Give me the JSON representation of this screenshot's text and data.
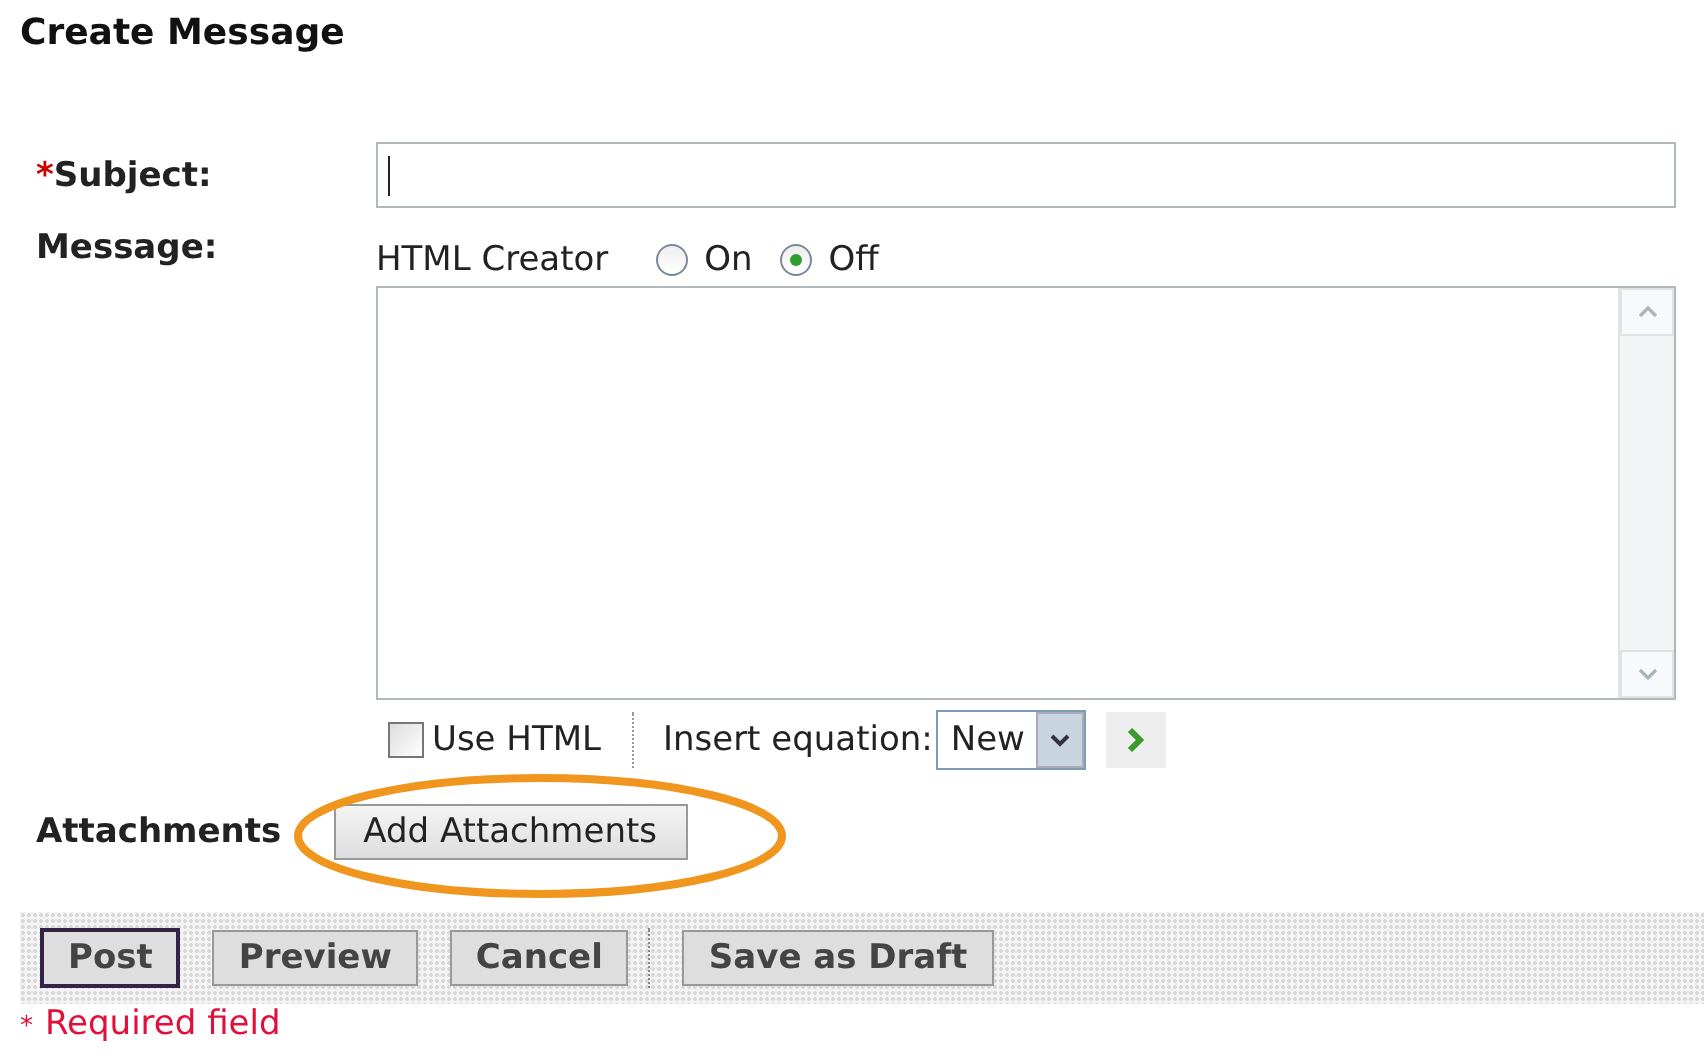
{
  "title": "Create Message",
  "subject": {
    "required_mark": "*",
    "label": "Subject:"
  },
  "message": {
    "label": "Message:",
    "html_creator": {
      "label": "HTML Creator",
      "options": [
        {
          "label": "On",
          "selected": false
        },
        {
          "label": "Off",
          "selected": true
        }
      ]
    }
  },
  "use_html": {
    "label": "Use HTML",
    "checked": false
  },
  "insert_equation": {
    "label": "Insert equation:",
    "value": "New"
  },
  "attachments": {
    "label": "Attachments",
    "button": "Add Attachments",
    "highlighted": true
  },
  "buttons": [
    {
      "label": "Post",
      "focused": true,
      "separator_before": false
    },
    {
      "label": "Preview",
      "focused": false,
      "separator_before": false
    },
    {
      "label": "Cancel",
      "focused": false,
      "separator_before": false
    },
    {
      "label": "Save as Draft",
      "focused": false,
      "separator_before": true
    }
  ],
  "footnote": {
    "mark": "*",
    "text": "Required field"
  }
}
